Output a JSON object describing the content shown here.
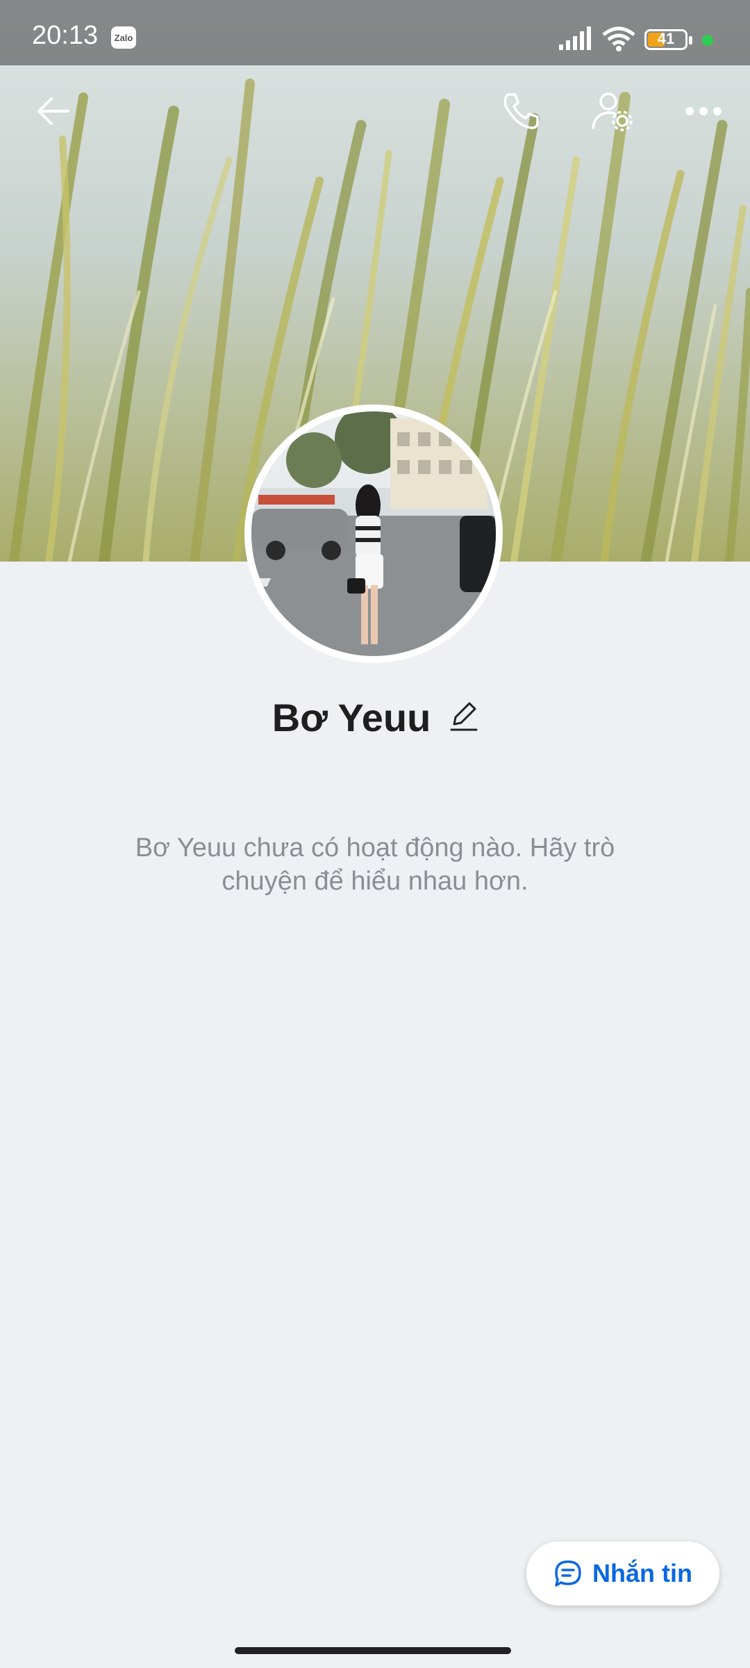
{
  "status_bar": {
    "time": "20:13",
    "app_badge": "Zalo",
    "battery": "41",
    "icons": [
      "signal-icon",
      "wifi-icon",
      "battery-icon",
      "green-dot-indicator"
    ]
  },
  "toolbar": {
    "icons": [
      "back-arrow-icon",
      "phone-call-icon",
      "user-settings-icon",
      "more-icon"
    ]
  },
  "profile": {
    "name": "Bơ Yeuu",
    "edit_icon": "pencil-icon",
    "empty_message": "Bơ Yeuu chưa có hoạt động nào. Hãy trò chuyện để hiểu nhau hơn."
  },
  "action": {
    "message_label": "Nhắn tin",
    "icon": "chat-bubble-icon"
  },
  "colors": {
    "accent": "#0a68e0",
    "background": "#eff0f4",
    "text_muted": "#8a8e93"
  }
}
